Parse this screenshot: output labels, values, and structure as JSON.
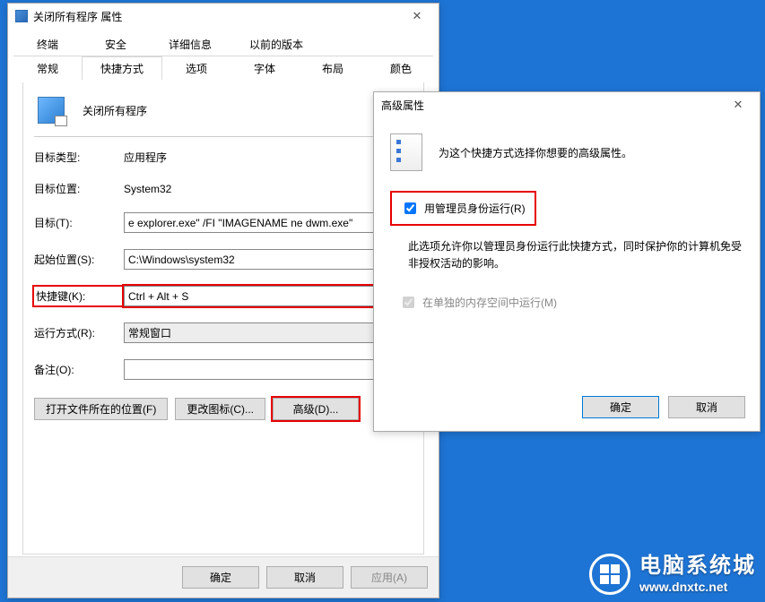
{
  "properties_window": {
    "title": "关闭所有程序 属性",
    "tabs_row1": [
      "终端",
      "安全",
      "详细信息",
      "以前的版本"
    ],
    "tabs_row2": [
      "常规",
      "快捷方式",
      "选项",
      "字体",
      "布局",
      "颜色"
    ],
    "active_tab": "快捷方式",
    "shortcut_name": "关闭所有程序",
    "fields": {
      "target_type": {
        "label": "目标类型:",
        "value": "应用程序"
      },
      "target_location": {
        "label": "目标位置:",
        "value": "System32"
      },
      "target": {
        "label": "目标(T):",
        "value": "e explorer.exe\" /FI \"IMAGENAME ne dwm.exe\""
      },
      "start_in": {
        "label": "起始位置(S):",
        "value": "C:\\Windows\\system32"
      },
      "shortcut_key": {
        "label": "快捷键(K):",
        "value": "Ctrl + Alt + S"
      },
      "run": {
        "label": "运行方式(R):",
        "value": "常规窗口"
      },
      "comment": {
        "label": "备注(O):",
        "value": ""
      }
    },
    "buttons": {
      "open_location": "打开文件所在的位置(F)",
      "change_icon": "更改图标(C)...",
      "advanced": "高级(D)..."
    },
    "footer": {
      "ok": "确定",
      "cancel": "取消",
      "apply": "应用(A)"
    }
  },
  "advanced_dialog": {
    "title": "高级属性",
    "intro": "为这个快捷方式选择你想要的高级属性。",
    "run_as_admin": {
      "label": "用管理员身份运行(R)",
      "checked": true
    },
    "run_as_admin_desc": "此选项允许你以管理员身份运行此快捷方式，同时保护你的计算机免受非授权活动的影响。",
    "separate_memory": {
      "label": "在单独的内存空间中运行(M)",
      "checked": true,
      "disabled": true
    },
    "footer": {
      "ok": "确定",
      "cancel": "取消"
    }
  },
  "watermark": {
    "title": "电脑系统城",
    "url": "www.dnxtc.net"
  }
}
